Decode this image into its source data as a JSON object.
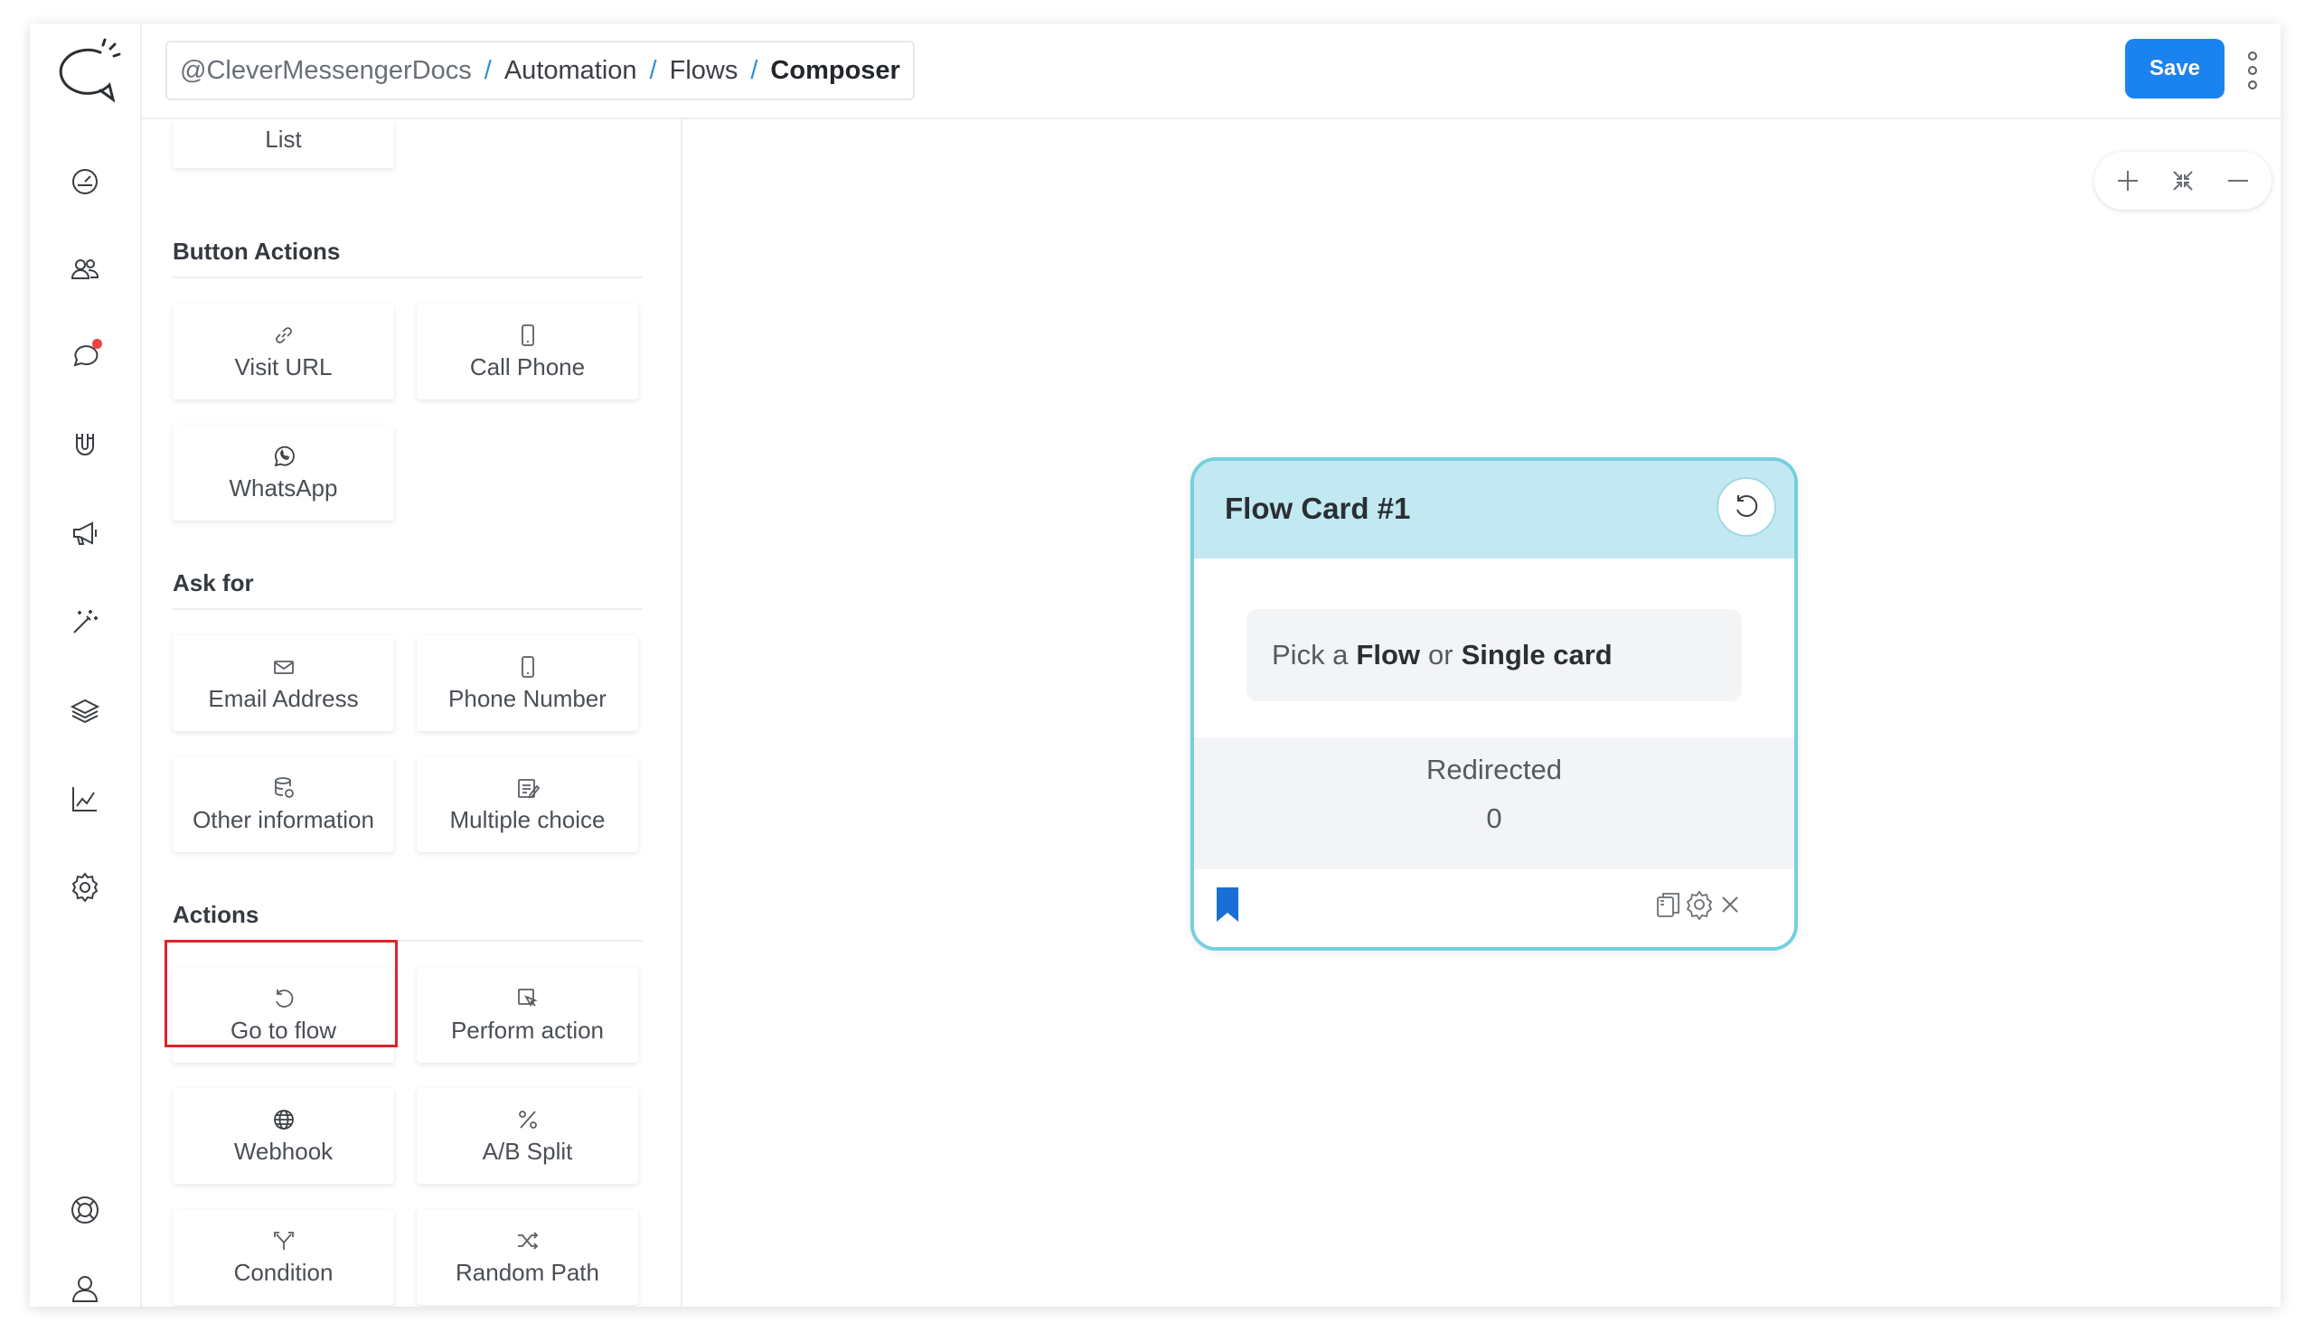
{
  "header": {
    "breadcrumb": [
      "@CleverMessengerDocs",
      "Automation",
      "Flows",
      "Composer"
    ],
    "save_label": "Save"
  },
  "sidebar": {
    "icons": [
      "dashboard-icon",
      "audience-icon",
      "live-chat-icon",
      "growth-tools-icon",
      "broadcast-icon",
      "automation-icon",
      "templates-icon",
      "analytics-icon",
      "settings-icon",
      "help-icon",
      "account-icon"
    ],
    "notification_color": "#f0413c"
  },
  "palette": {
    "top_partial": {
      "label": "List"
    },
    "sections": [
      {
        "title": "Button Actions",
        "items": [
          {
            "label": "Visit URL",
            "icon": "link-icon"
          },
          {
            "label": "Call Phone",
            "icon": "phone-icon"
          },
          {
            "label": "WhatsApp",
            "icon": "whatsapp-icon"
          }
        ]
      },
      {
        "title": "Ask for",
        "items": [
          {
            "label": "Email Address",
            "icon": "envelope-icon"
          },
          {
            "label": "Phone Number",
            "icon": "phone-icon"
          },
          {
            "label": "Other information",
            "icon": "database-icon"
          },
          {
            "label": "Multiple choice",
            "icon": "checklist-icon"
          }
        ]
      },
      {
        "title": "Actions",
        "items": [
          {
            "label": "Go to flow",
            "icon": "redo-icon",
            "highlighted": true
          },
          {
            "label": "Perform action",
            "icon": "cursor-icon"
          },
          {
            "label": "Webhook",
            "icon": "globe-icon"
          },
          {
            "label": "A/B Split",
            "icon": "percent-icon"
          },
          {
            "label": "Condition",
            "icon": "split-arrow-icon"
          },
          {
            "label": "Random Path",
            "icon": "shuffle-icon"
          }
        ]
      }
    ]
  },
  "canvas": {
    "zoom_controls": [
      "zoom-in-icon",
      "fit-screen-icon",
      "zoom-out-icon"
    ],
    "card": {
      "title": "Flow Card #1",
      "pick_prefix": "Pick a",
      "pick_flow": "Flow",
      "pick_or": "or",
      "pick_single": "Single card",
      "stat_label": "Redirected",
      "stat_value": "0",
      "header_color": "#c2e9f2",
      "border_color": "#74cfe0",
      "bookmark_color": "#1a6fd6"
    }
  },
  "colors": {
    "accent": "#1a83f0",
    "breadcrumb_separator": "#2d8fdc",
    "highlight_box": "#e0232a"
  }
}
